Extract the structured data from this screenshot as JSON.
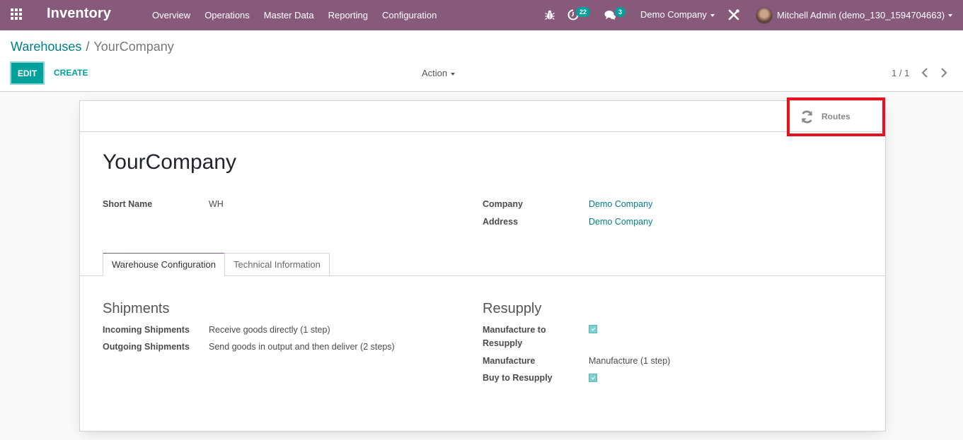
{
  "navbar": {
    "app_name": "Inventory",
    "menu": [
      {
        "label": "Overview"
      },
      {
        "label": "Operations"
      },
      {
        "label": "Master Data"
      },
      {
        "label": "Reporting"
      },
      {
        "label": "Configuration"
      }
    ],
    "systray": {
      "debug_icon": "bug-icon",
      "activity_icon": "clock-icon",
      "activity_count": "22",
      "messages_icon": "comments-icon",
      "messages_count": "3",
      "company": "Demo Company",
      "tools_icon": "tools-icon",
      "user": "Mitchell Admin (demo_130_1594704663)"
    },
    "color": "#875a7b"
  },
  "control_panel": {
    "breadcrumb": [
      {
        "label": "Warehouses"
      },
      {
        "label": "YourCompany"
      }
    ],
    "breadcrumb_separator": "/",
    "edit_label": "EDIT",
    "create_label": "CREATE",
    "action_label": "Action",
    "pager": "1 / 1"
  },
  "form": {
    "smart_buttons": [
      {
        "label": "Routes",
        "icon": "refresh-icon",
        "highlighted": true
      }
    ],
    "title": "YourCompany",
    "fields_left": [
      {
        "label": "Short Name",
        "value": "WH"
      }
    ],
    "fields_right": [
      {
        "label": "Company",
        "value": "Demo Company",
        "link": true
      },
      {
        "label": "Address",
        "value": "Demo Company",
        "link": true
      }
    ],
    "tabs": [
      {
        "label": "Warehouse Configuration",
        "active": true
      },
      {
        "label": "Technical Information",
        "active": false
      }
    ],
    "shipments": {
      "title": "Shipments",
      "fields": [
        {
          "label": "Incoming Shipments",
          "value": "Receive goods directly (1 step)"
        },
        {
          "label": "Outgoing Shipments",
          "value": "Send goods in output and then deliver (2 steps)"
        }
      ]
    },
    "resupply": {
      "title": "Resupply",
      "manufacture_to_resupply_label_1": "Manufacture to",
      "manufacture_to_resupply_label_2": "Resupply",
      "manufacture_to_resupply_checked": true,
      "manufacture_label": "Manufacture",
      "manufacture_value": "Manufacture (1 step)",
      "buy_to_resupply_label": "Buy to Resupply",
      "buy_to_resupply_checked": true
    }
  },
  "colors": {
    "primary": "#00a09d",
    "link": "#017e84",
    "highlight": "#e6121f"
  }
}
